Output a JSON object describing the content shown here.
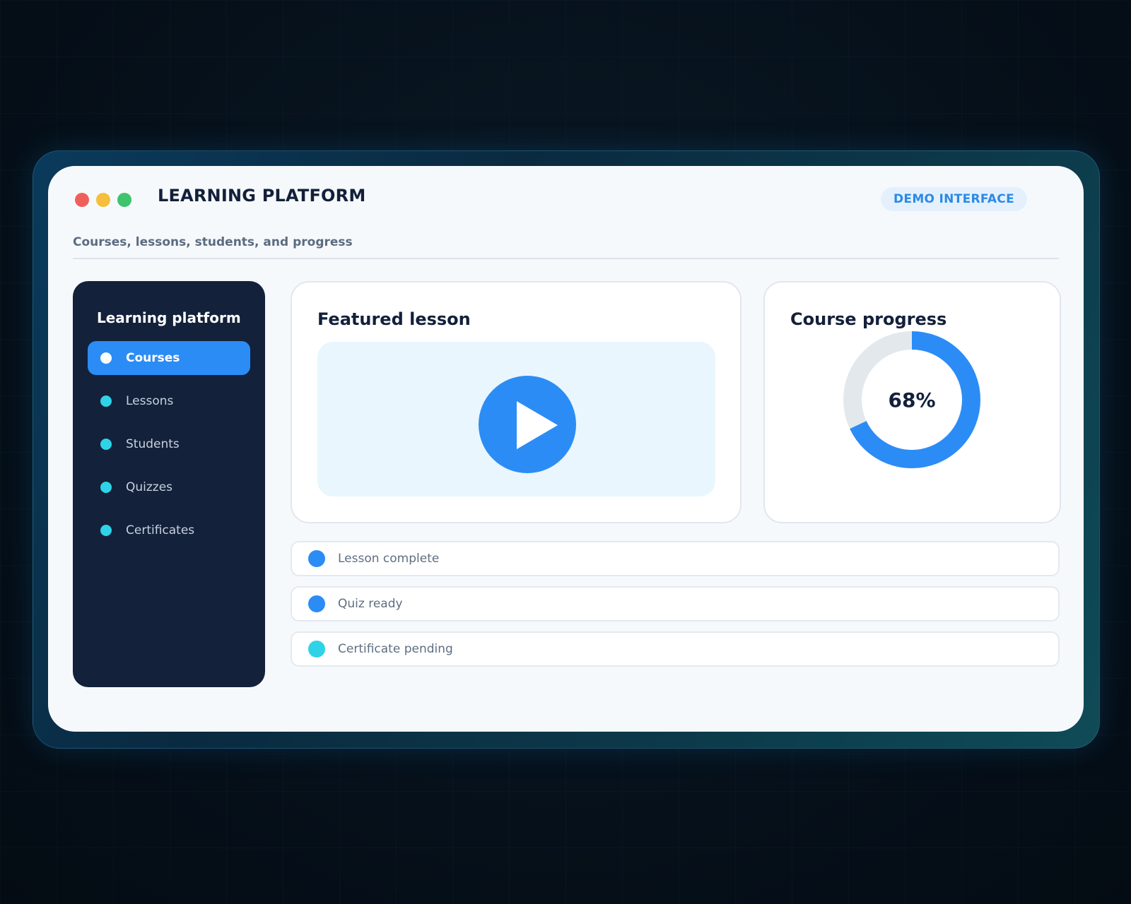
{
  "app": {
    "title": "LEARNING PLATFORM",
    "badge": "DEMO INTERFACE",
    "subtitle": "Courses, lessons, students, and progress"
  },
  "window_controls": {
    "colors": [
      "#f0605b",
      "#f5bf3c",
      "#3ec46d"
    ]
  },
  "sidebar": {
    "title": "Learning platform",
    "items": [
      {
        "label": "Courses",
        "active": true
      },
      {
        "label": "Lessons",
        "active": false
      },
      {
        "label": "Students",
        "active": false
      },
      {
        "label": "Quizzes",
        "active": false
      },
      {
        "label": "Certificates",
        "active": false
      }
    ]
  },
  "featured": {
    "title": "Featured lesson",
    "play_icon": "play-icon"
  },
  "progress": {
    "title": "Course progress",
    "value_label": "68%",
    "value": 68,
    "track_color": "#e3e8ed",
    "fill_color": "#2b8cf5"
  },
  "status_items": [
    {
      "label": "Lesson complete",
      "color": "#2b8cf5"
    },
    {
      "label": "Quiz ready",
      "color": "#2b8cf5"
    },
    {
      "label": "Certificate pending",
      "color": "#2fd3e8"
    }
  ],
  "colors": {
    "accent": "#2b8cf5",
    "sidebar_bg": "#13213a",
    "cyan": "#2fd3e8"
  }
}
